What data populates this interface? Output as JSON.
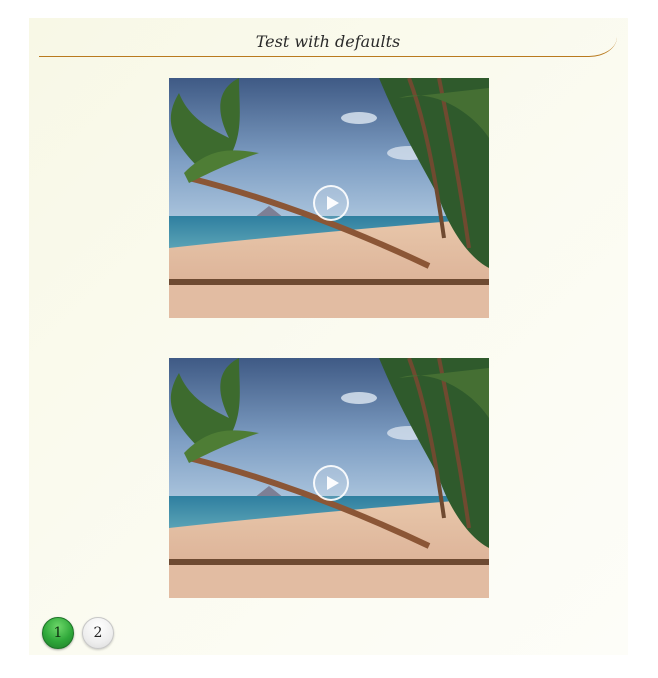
{
  "header": {
    "title": "Test with defaults"
  },
  "videos": [
    {
      "name": "video-1",
      "play_icon": "play-icon"
    },
    {
      "name": "video-2",
      "play_icon": "play-icon"
    }
  ],
  "pagination": {
    "current": 1,
    "pages": [
      "1",
      "2"
    ],
    "colors": {
      "active": "#2fa83a",
      "inactive": "#eeeeee"
    }
  },
  "colors": {
    "header_rule": "#b97a1e",
    "panel_bg": "#f8f8e6"
  }
}
